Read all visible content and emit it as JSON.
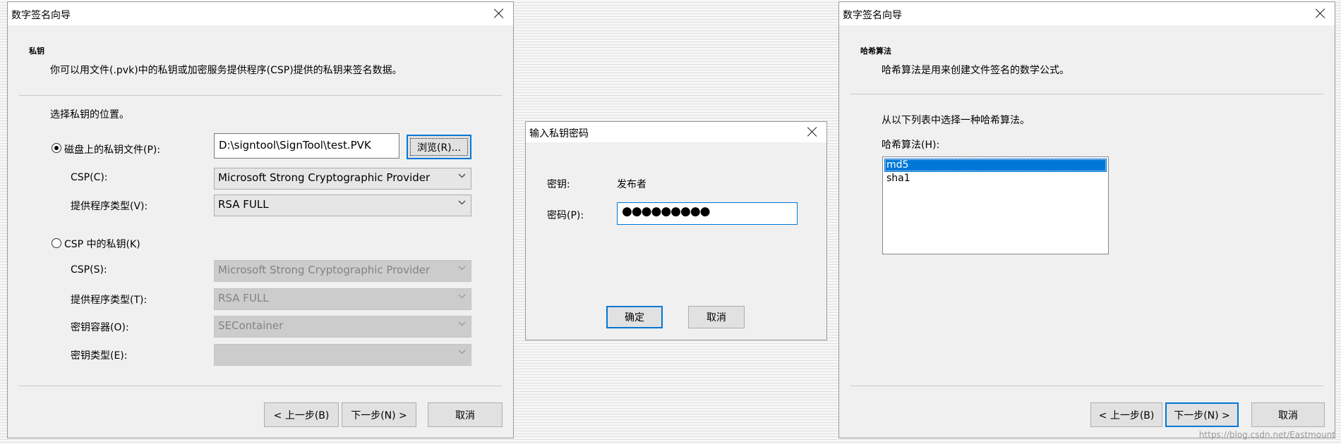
{
  "dialog1": {
    "title": "数字签名向导",
    "heading": "私钥",
    "description": "你可以用文件(.pvk)中的私钥或加密服务提供程序(CSP)提供的私钥来签名数据。",
    "prompt": "选择私钥的位置。",
    "option_file": {
      "label": "磁盘上的私钥文件(P):",
      "selected": true,
      "path_value": "D:\\signtool\\SignTool\\test.PVK",
      "browse_label": "浏览(R)...",
      "csp_label": "CSP(C):",
      "csp_value": "Microsoft Strong Cryptographic Provider",
      "type_label": "提供程序类型(V):",
      "type_value": "RSA FULL"
    },
    "option_csp": {
      "label": "CSP 中的私钥(K)",
      "selected": false,
      "csp_label": "CSP(S):",
      "csp_value": "Microsoft Strong Cryptographic Provider",
      "type_label": "提供程序类型(T):",
      "type_value": "RSA FULL",
      "container_label": "密钥容器(O):",
      "container_value": "SEContainer",
      "keytype_label": "密钥类型(E):",
      "keytype_value": ""
    },
    "buttons": {
      "back": "< 上一步(B)",
      "next": "下一步(N) >",
      "cancel": "取消"
    }
  },
  "dialog2": {
    "title": "输入私钥密码",
    "key_label": "密钥:",
    "key_value": "发布者",
    "password_label": "密码(P):",
    "password_value": "●●●●●●●●●",
    "buttons": {
      "ok": "确定",
      "cancel": "取消"
    }
  },
  "dialog3": {
    "title": "数字签名向导",
    "heading": "哈希算法",
    "description": "哈希算法是用来创建文件签名的数学公式。",
    "prompt": "从以下列表中选择一种哈希算法。",
    "list_label": "哈希算法(H):",
    "algorithms": [
      "md5",
      "sha1"
    ],
    "selected_algorithm": "md5",
    "buttons": {
      "back": "< 上一步(B)",
      "next": "下一步(N) >",
      "cancel": "取消"
    }
  },
  "watermark": "https://blog.csdn.net/Eastmount",
  "colors": {
    "accent": "#0078d7",
    "dialog_bg": "#f0f0f0",
    "titlebar_bg": "#ffffff"
  }
}
